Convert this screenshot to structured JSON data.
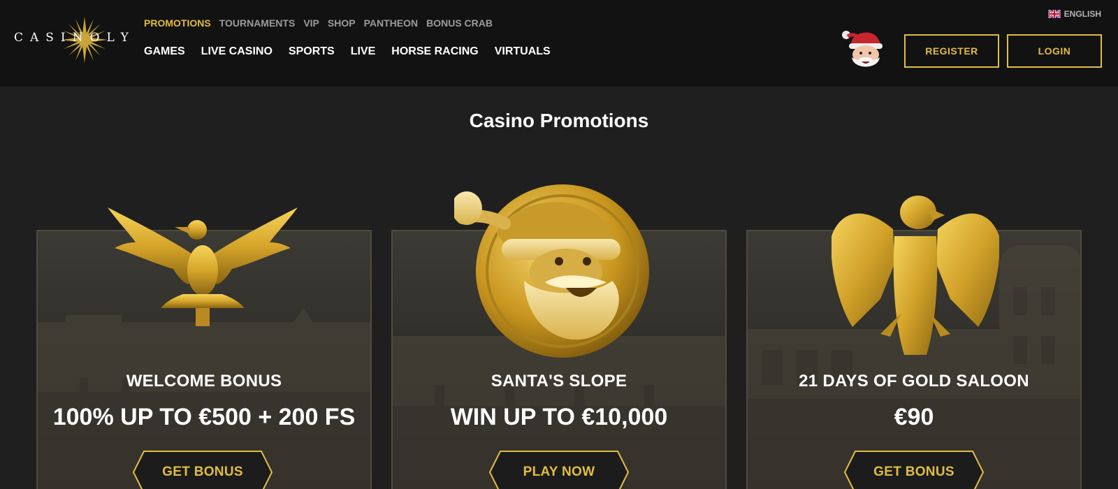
{
  "brand": {
    "logo_text": "CASINOLY"
  },
  "header": {
    "language": "ENGLISH",
    "nav_top": [
      {
        "label": "PROMOTIONS",
        "active": true
      },
      {
        "label": "TOURNAMENTS"
      },
      {
        "label": "VIP"
      },
      {
        "label": "SHOP"
      },
      {
        "label": "PANTHEON"
      },
      {
        "label": "BONUS CRAB"
      }
    ],
    "nav_main": [
      {
        "label": "GAMES"
      },
      {
        "label": "LIVE CASINO"
      },
      {
        "label": "SPORTS"
      },
      {
        "label": "LIVE"
      },
      {
        "label": "HORSE RACING"
      },
      {
        "label": "VIRTUALS"
      }
    ],
    "register_label": "REGISTER",
    "login_label": "LOGIN"
  },
  "main": {
    "title": "Casino Promotions",
    "cards": [
      {
        "heading": "WELCOME BONUS",
        "offer": "100% UP TO €500 + 200 FS",
        "button": "GET BONUS",
        "icon": "gold-eagle-icon"
      },
      {
        "heading": "SANTA'S SLOPE",
        "offer": "WIN UP TO €10,000",
        "button": "PLAY NOW",
        "icon": "santa-coin-icon"
      },
      {
        "heading": "21 DAYS OF GOLD SALOON",
        "offer": "€90",
        "button": "GET BONUS",
        "icon": "gold-eagle-statue-icon"
      }
    ]
  },
  "colors": {
    "accent_gold": "#e2bd43",
    "header_bg": "#121212",
    "page_bg": "#1f1f1f",
    "nav_inactive": "#9c9c9c"
  }
}
